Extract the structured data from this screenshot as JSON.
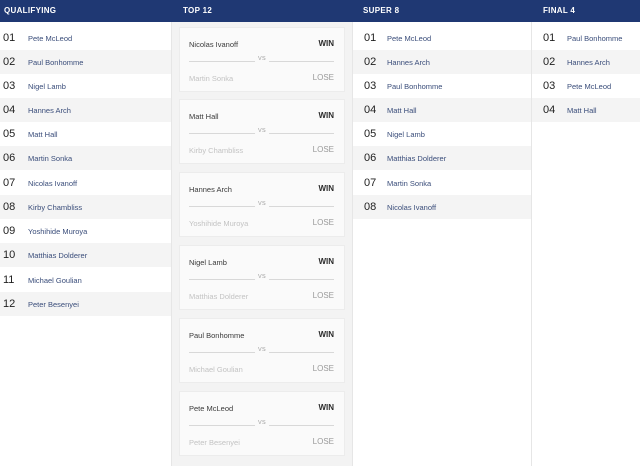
{
  "columns": {
    "qualifying": "QUALIFYING",
    "top12": "TOP 12",
    "super8": "SUPER 8",
    "final4": "FINAL 4"
  },
  "qualifying": [
    {
      "rank": "01",
      "name": "Pete McLeod"
    },
    {
      "rank": "02",
      "name": "Paul Bonhomme"
    },
    {
      "rank": "03",
      "name": "Nigel Lamb"
    },
    {
      "rank": "04",
      "name": "Hannes Arch"
    },
    {
      "rank": "05",
      "name": "Matt Hall"
    },
    {
      "rank": "06",
      "name": "Martin Sonka"
    },
    {
      "rank": "07",
      "name": "Nicolas Ivanoff"
    },
    {
      "rank": "08",
      "name": "Kirby Chambliss"
    },
    {
      "rank": "09",
      "name": "Yoshihide Muroya"
    },
    {
      "rank": "10",
      "name": "Matthias Dolderer"
    },
    {
      "rank": "11",
      "name": "Michael Goulian"
    },
    {
      "rank": "12",
      "name": "Peter Besenyei"
    }
  ],
  "top12": [
    {
      "winner": "Nicolas Ivanoff",
      "loser": "Martin Sonka",
      "win_label": "WIN",
      "lose_label": "LOSE",
      "vs": "VS"
    },
    {
      "winner": "Matt Hall",
      "loser": "Kirby Chambliss",
      "win_label": "WIN",
      "lose_label": "LOSE",
      "vs": "VS"
    },
    {
      "winner": "Hannes Arch",
      "loser": "Yoshihide Muroya",
      "win_label": "WIN",
      "lose_label": "LOSE",
      "vs": "VS"
    },
    {
      "winner": "Nigel Lamb",
      "loser": "Matthias Dolderer",
      "win_label": "WIN",
      "lose_label": "LOSE",
      "vs": "VS"
    },
    {
      "winner": "Paul Bonhomme",
      "loser": "Michael Goulian",
      "win_label": "WIN",
      "lose_label": "LOSE",
      "vs": "VS"
    },
    {
      "winner": "Pete McLeod",
      "loser": "Peter Besenyei",
      "win_label": "WIN",
      "lose_label": "LOSE",
      "vs": "VS"
    }
  ],
  "super8": [
    {
      "rank": "01",
      "name": "Pete McLeod"
    },
    {
      "rank": "02",
      "name": "Hannes Arch"
    },
    {
      "rank": "03",
      "name": "Paul Bonhomme"
    },
    {
      "rank": "04",
      "name": "Matt Hall"
    },
    {
      "rank": "05",
      "name": "Nigel Lamb"
    },
    {
      "rank": "06",
      "name": "Matthias Dolderer"
    },
    {
      "rank": "07",
      "name": "Martin Sonka"
    },
    {
      "rank": "08",
      "name": "Nicolas Ivanoff"
    }
  ],
  "final4": [
    {
      "rank": "01",
      "name": "Paul Bonhomme"
    },
    {
      "rank": "02",
      "name": "Hannes Arch"
    },
    {
      "rank": "03",
      "name": "Pete McLeod"
    },
    {
      "rank": "04",
      "name": "Matt Hall"
    }
  ],
  "colors": {
    "header": "#1f3873",
    "name_link": "#3a4d7a",
    "loser_text": "#c3c3c3"
  }
}
